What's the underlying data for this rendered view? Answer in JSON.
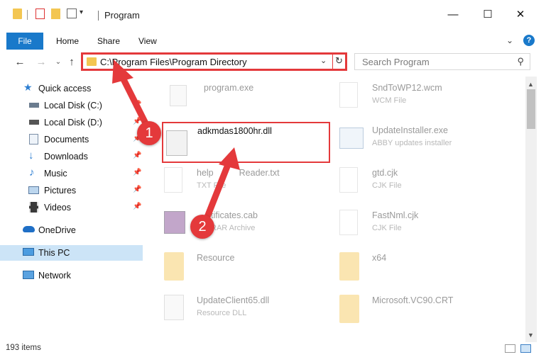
{
  "window": {
    "title": "Program",
    "controls": [
      "minimize-icon",
      "maximize-icon",
      "close-icon"
    ]
  },
  "ribbon": {
    "tabs": [
      "File",
      "Home",
      "Share",
      "View"
    ],
    "help_label": "?"
  },
  "address": {
    "path": "C:\\Program Files\\Program Directory",
    "search_placeholder": "Search Program"
  },
  "nav": {
    "items": [
      {
        "label": "Quick access",
        "icon": "star-icon"
      },
      {
        "label": "Local Disk (C:)",
        "icon": "drive-icon"
      },
      {
        "label": "Local Disk (D:)",
        "icon": "drive-icon"
      },
      {
        "label": "Documents",
        "icon": "documents-icon"
      },
      {
        "label": "Downloads",
        "icon": "download-icon"
      },
      {
        "label": "Music",
        "icon": "music-icon"
      },
      {
        "label": "Pictures",
        "icon": "pictures-icon"
      },
      {
        "label": "Videos",
        "icon": "video-icon"
      },
      {
        "label": "OneDrive",
        "icon": "cloud-icon"
      },
      {
        "label": "This PC",
        "icon": "computer-icon"
      },
      {
        "label": "Network",
        "icon": "network-icon"
      }
    ]
  },
  "files": [
    {
      "name": "program.exe",
      "type": ""
    },
    {
      "name": "SndToWP12.wcm",
      "type": "WCM File"
    },
    {
      "name": "adkmdas1800hr.dll",
      "type": ""
    },
    {
      "name": "UpdateInstaller.exe",
      "type": "ABBY updates installer"
    },
    {
      "name": "help",
      "name_tail": "Reader.txt",
      "type": "TXT File"
    },
    {
      "name": "gtd.cjk",
      "type": "CJK File"
    },
    {
      "name": "",
      "name_tail": "tificates.cab",
      "type": "",
      "type_tail": "RAR Archive"
    },
    {
      "name": "FastNml.cjk",
      "type": "CJK File"
    },
    {
      "name": "Resource",
      "type": ""
    },
    {
      "name": "x64",
      "type": ""
    },
    {
      "name": "UpdateClient65.dll",
      "type": "Resource DLL"
    },
    {
      "name": "Microsoft.VC90.CRT",
      "type": ""
    }
  ],
  "status": {
    "items_count": "193 items"
  },
  "annotations": {
    "marker_1": "1",
    "marker_2": "2",
    "accent_color": "#e4393b"
  },
  "colors": {
    "file_tab": "#1979ca",
    "selected_nav": "#cce4f7",
    "folder": "#f3c652"
  }
}
